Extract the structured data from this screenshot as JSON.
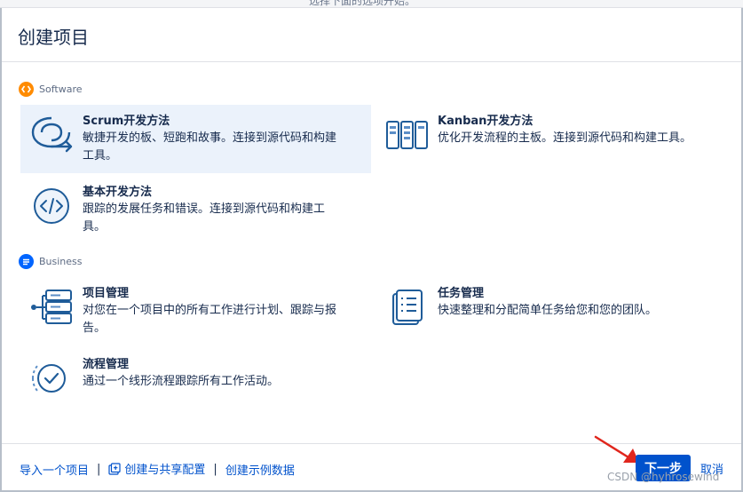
{
  "top_strip": {
    "text": "选择下面的选项开始。"
  },
  "dialog": {
    "title": "创建项目"
  },
  "sections": {
    "software": {
      "label": "Software",
      "color": "#ff8b00",
      "icon": "code-brackets-icon",
      "templates": [
        {
          "title": "Scrum开发方法",
          "desc_line1": "敏捷开发的板、短跑和故事。连接到源代码和构建",
          "desc_line2": "工具。",
          "icon": "scrum-cycle-icon",
          "selected": true
        },
        {
          "title": "Kanban开发方法",
          "desc_line1": "优化开发流程的主板。连接到源代码和构建工具。",
          "icon": "kanban-board-icon"
        },
        {
          "title": "基本开发方法",
          "desc_line1": "跟踪的发展任务和错误。连接到源代码和构建工",
          "desc_line2": "具。",
          "icon": "code-circle-icon"
        }
      ]
    },
    "business": {
      "label": "Business",
      "color": "#0065ff",
      "icon": "list-icon",
      "templates": [
        {
          "title": "项目管理",
          "desc_line1": "对您在一个项目中的所有工作进行计划、跟踪与报",
          "desc_line2": "告。",
          "icon": "project-stack-icon"
        },
        {
          "title": "任务管理",
          "desc_line1": "快速整理和分配简单任务给您和您的团队。",
          "icon": "task-list-icon"
        },
        {
          "title": "流程管理",
          "desc_line1": "通过一个线形流程跟踪所有工作活动。",
          "icon": "process-check-icon"
        }
      ]
    }
  },
  "footer": {
    "import_link": "导入一个项目",
    "separator": "|",
    "share_config_link": "创建与共享配置",
    "sample_data_link": "创建示例数据",
    "next_button": "下一步",
    "cancel_link": "取消"
  },
  "watermark": "CSDN @hyhrosewind",
  "colors": {
    "accent": "#0052cc",
    "selected_bg": "#ebf2fb",
    "icon_blue": "#1f5c99",
    "annotation_red": "#e0261d"
  }
}
